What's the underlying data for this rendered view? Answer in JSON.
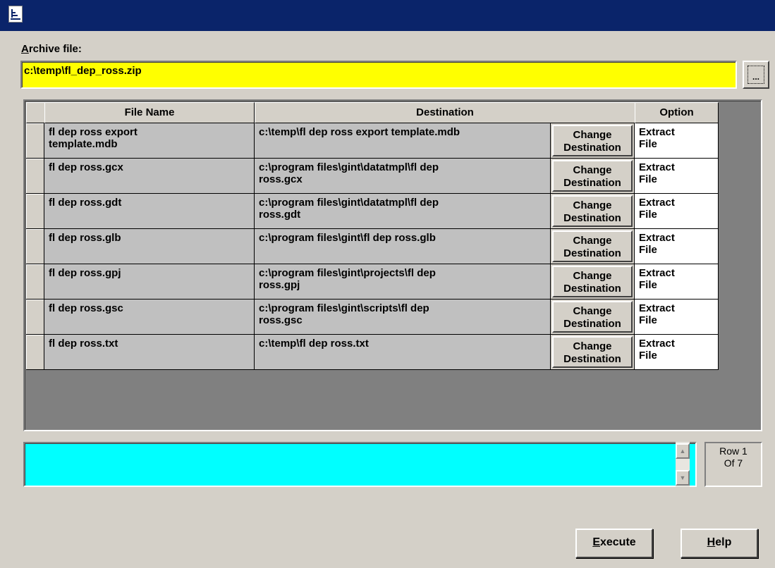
{
  "window": {
    "title": ""
  },
  "archive": {
    "label_accel": "A",
    "label_rest": "rchive file:",
    "value": "c:\\temp\\fl_dep_ross.zip",
    "browse_label": "..."
  },
  "grid": {
    "columns": {
      "file_name": "File Name",
      "destination": "Destination",
      "option": "Option"
    },
    "rows": [
      {
        "file_line1": "fl dep ross export",
        "file_line2": "template.mdb",
        "dest_line1": "c:\\temp\\fl dep ross export template.mdb",
        "dest_line2": "",
        "button_line1": "Change",
        "button_line2": "Destination",
        "opt_line1": "Extract",
        "opt_line2": "File"
      },
      {
        "file_line1": "fl dep ross.gcx",
        "file_line2": "",
        "dest_line1": "c:\\program files\\gint\\datatmpl\\fl dep",
        "dest_line2": "ross.gcx",
        "button_line1": "Change",
        "button_line2": "Destination",
        "opt_line1": "Extract",
        "opt_line2": "File"
      },
      {
        "file_line1": "fl dep ross.gdt",
        "file_line2": "",
        "dest_line1": "c:\\program files\\gint\\datatmpl\\fl dep",
        "dest_line2": "ross.gdt",
        "button_line1": "Change",
        "button_line2": "Destination",
        "opt_line1": "Extract",
        "opt_line2": "File"
      },
      {
        "file_line1": "fl dep ross.glb",
        "file_line2": "",
        "dest_line1": "c:\\program files\\gint\\fl dep ross.glb",
        "dest_line2": "",
        "button_line1": "Change",
        "button_line2": "Destination",
        "opt_line1": "Extract",
        "opt_line2": "File"
      },
      {
        "file_line1": "fl dep ross.gpj",
        "file_line2": "",
        "dest_line1": "c:\\program files\\gint\\projects\\fl dep",
        "dest_line2": "ross.gpj",
        "button_line1": "Change",
        "button_line2": "Destination",
        "opt_line1": "Extract",
        "opt_line2": "File"
      },
      {
        "file_line1": "fl dep ross.gsc",
        "file_line2": "",
        "dest_line1": "c:\\program files\\gint\\scripts\\fl dep",
        "dest_line2": "ross.gsc",
        "button_line1": "Change",
        "button_line2": "Destination",
        "opt_line1": "Extract",
        "opt_line2": "File"
      },
      {
        "file_line1": "fl dep ross.txt",
        "file_line2": "",
        "dest_line1": "c:\\temp\\fl dep ross.txt",
        "dest_line2": "",
        "button_line1": "Change",
        "button_line2": "Destination",
        "opt_line1": "Extract",
        "opt_line2": "File"
      }
    ]
  },
  "status": {
    "text": ""
  },
  "row_counter": {
    "line1": "Row 1",
    "line2": "Of 7"
  },
  "buttons": {
    "execute_accel": "E",
    "execute_rest": "xecute",
    "help_accel": "H",
    "help_rest": "elp"
  },
  "colors": {
    "titlebar": "#0a246a",
    "archive_field": "#ffff00",
    "status_field": "#00ffff",
    "dialog": "#d4d0c8"
  },
  "icons": {
    "app": "app-window-icon",
    "scroll_up": "arrow-up-icon",
    "scroll_down": "arrow-down-icon"
  }
}
